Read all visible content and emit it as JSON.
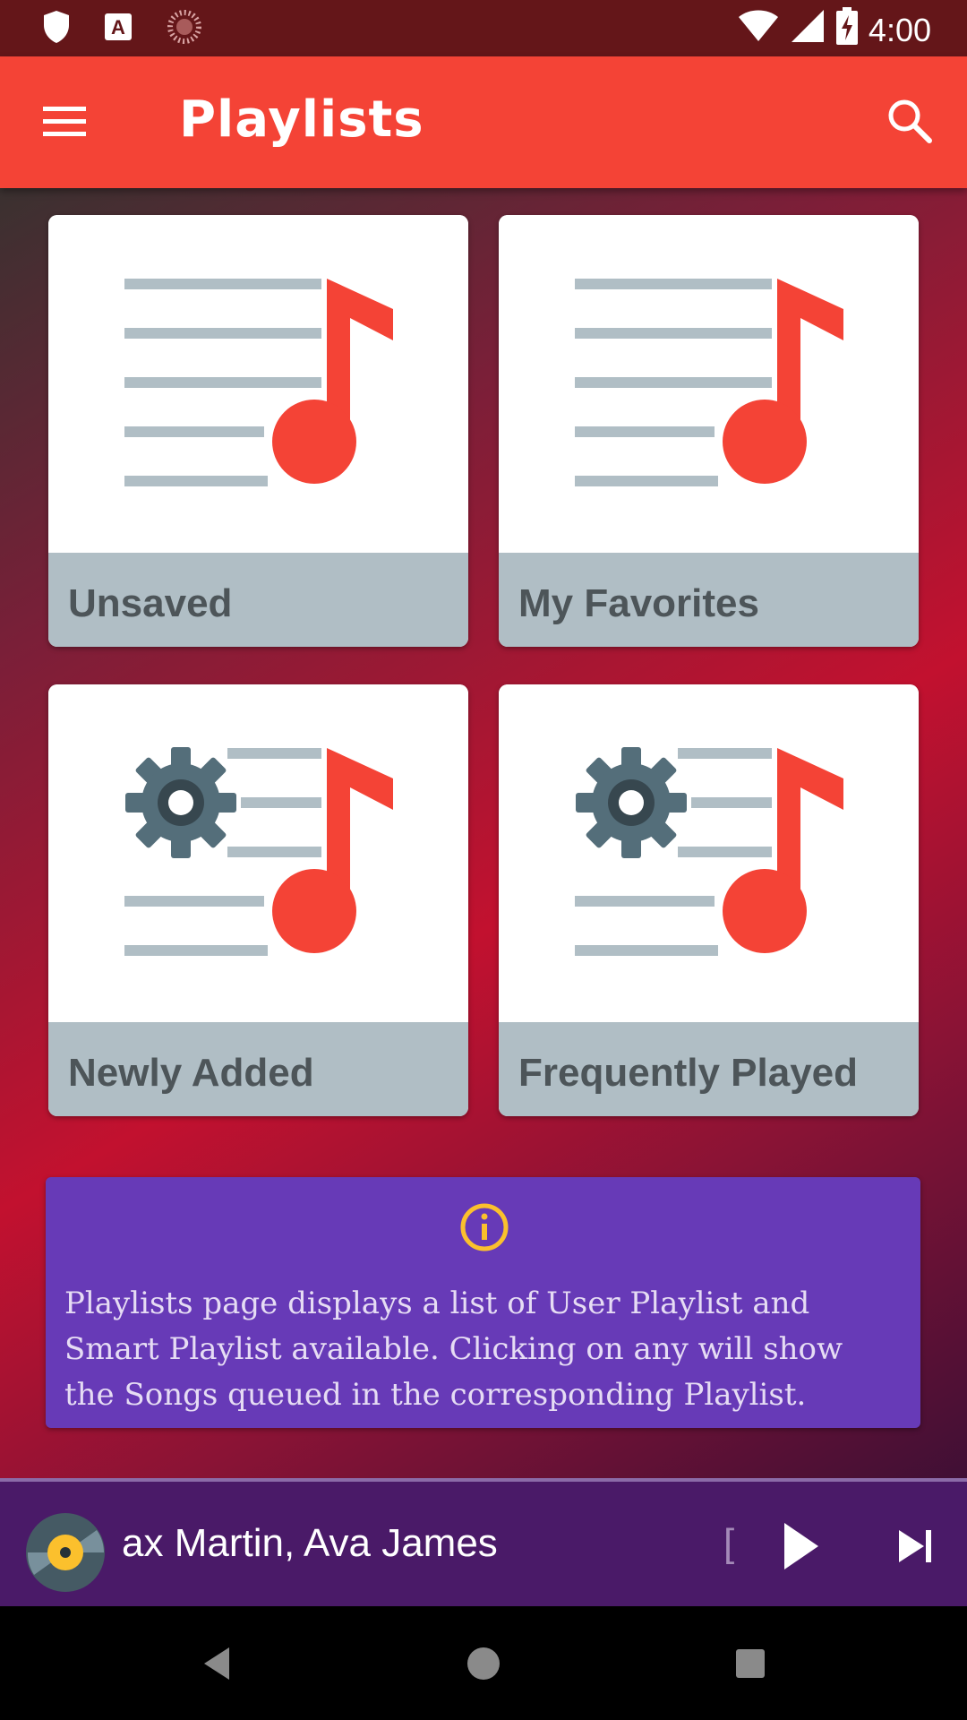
{
  "status_bar": {
    "time": "4:00",
    "left_icons": [
      "shield-icon",
      "font-a-icon",
      "sync-spinner-icon"
    ],
    "right_icons": [
      "wifi-icon",
      "signal-icon",
      "battery-charging-icon"
    ]
  },
  "toolbar": {
    "title": "Playlists",
    "menu_icon": "hamburger-menu-icon",
    "search_icon": "search-icon",
    "color": "#f44336"
  },
  "playlists": [
    {
      "label": "Unsaved",
      "type": "user"
    },
    {
      "label": "My Favorites",
      "type": "user"
    },
    {
      "label": "Newly Added",
      "type": "smart"
    },
    {
      "label": "Frequently Played",
      "type": "smart"
    }
  ],
  "info": {
    "icon": "info-icon",
    "text": "Playlists page displays a list of User Playlist and Smart Playlist available. Clicking on any will show the Songs queued in the corresponding Playlist."
  },
  "player": {
    "track_text": "ax Martin, Ava James",
    "fade_text": "[",
    "play_icon": "play-icon",
    "next_icon": "skip-next-icon"
  },
  "colors": {
    "accent_red": "#f44336",
    "card_label_bg": "#b0bec5",
    "info_bg": "#673ab7",
    "player_bg": "#4a1a68",
    "status_bar_bg": "#641619"
  }
}
